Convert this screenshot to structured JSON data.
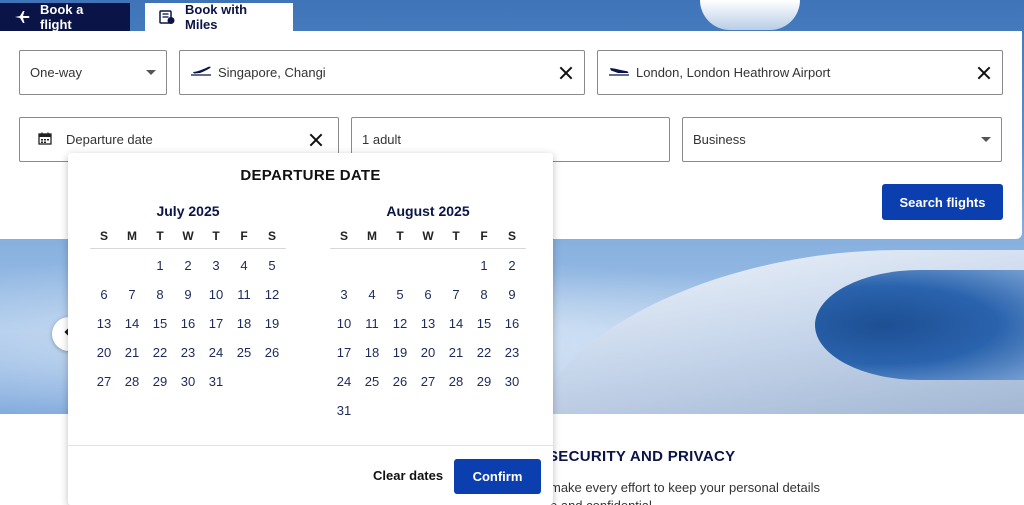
{
  "tabs": {
    "book_flight": "Book a flight",
    "book_miles": "Book with Miles"
  },
  "search": {
    "trip_type": "One-way",
    "from": "Singapore, Changi",
    "to": "London, London Heathrow Airport",
    "date_placeholder": "Departure date",
    "passengers": "1 adult",
    "cabin": "Business",
    "search_button": "Search flights"
  },
  "calendar": {
    "title": "DEPARTURE DATE",
    "weekdays": [
      "S",
      "M",
      "T",
      "W",
      "T",
      "F",
      "S"
    ],
    "months": [
      {
        "name": "July 2025",
        "first_weekday": 2,
        "days": 31
      },
      {
        "name": "August 2025",
        "first_weekday": 5,
        "days": 31
      }
    ],
    "clear_label": "Clear dates",
    "confirm_label": "Confirm"
  },
  "info": {
    "title": "SECURITY AND PRIVACY",
    "text": "make every effort to keep your personal details\ne and confidential"
  },
  "colors": {
    "navy": "#0b1447",
    "primary_button": "#0b3fb0"
  },
  "icons": {
    "flight_tab": "airplane-icon",
    "miles_tab": "miles-icon",
    "trip_caret": "chevron-down-icon",
    "from_plane": "takeoff-icon",
    "to_plane": "landing-icon",
    "date": "calendar-icon",
    "clear": "close-icon",
    "prev": "chevron-left-icon"
  }
}
